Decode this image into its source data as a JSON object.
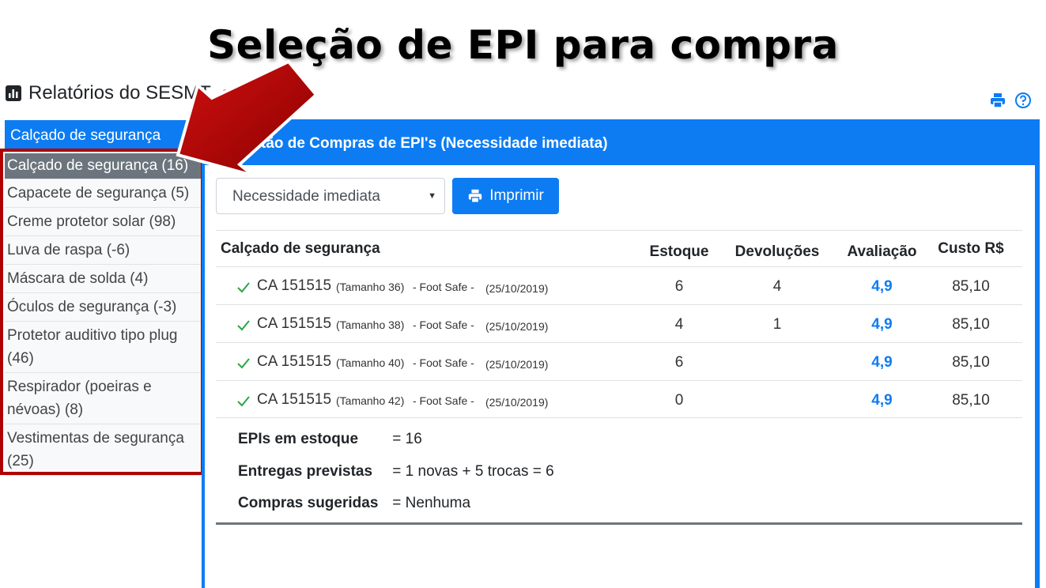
{
  "slide": {
    "title": "Seleção de EPI para compra"
  },
  "app": {
    "title": "Relatórios do SESMT"
  },
  "sidebar": {
    "selected_label": "Calçado de segurança",
    "items": [
      {
        "label": "Calçado de segurança (16)"
      },
      {
        "label": "Capacete de segurança (5)"
      },
      {
        "label": "Creme protetor solar (98)"
      },
      {
        "label": "Luva de raspa (-6)"
      },
      {
        "label": "Máscara de solda (4)"
      },
      {
        "label": "Óculos de segurança (-3)"
      },
      {
        "label": "Protetor auditivo tipo plug (46)"
      },
      {
        "label": "Respirador (poeiras e névoas) (8)"
      },
      {
        "label": "Vestimentas de segurança (25)"
      }
    ]
  },
  "panel": {
    "title": "Sugestão de Compras de EPI's (Necessidade imediata)",
    "filter_value": "Necessidade imediata",
    "print_label": "Imprimir"
  },
  "table": {
    "headers": {
      "item": "Calçado de segurança",
      "estoque": "Estoque",
      "devolucoes": "Devoluções",
      "avaliacao": "Avaliação",
      "custo": "Custo R$"
    },
    "rows": [
      {
        "ca": "CA 151515",
        "tamanho": "(Tamanho 36)",
        "fabricante": "- Foot Safe -",
        "data": "(25/10/2019)",
        "estoque": "6",
        "devolucoes": "4",
        "avaliacao": "4,9",
        "custo": "85,10"
      },
      {
        "ca": "CA 151515",
        "tamanho": "(Tamanho 38)",
        "fabricante": "- Foot Safe -",
        "data": "(25/10/2019)",
        "estoque": "4",
        "devolucoes": "1",
        "avaliacao": "4,9",
        "custo": "85,10"
      },
      {
        "ca": "CA 151515",
        "tamanho": "(Tamanho 40)",
        "fabricante": "- Foot Safe -",
        "data": "(25/10/2019)",
        "estoque": "6",
        "devolucoes": "",
        "avaliacao": "4,9",
        "custo": "85,10"
      },
      {
        "ca": "CA 151515",
        "tamanho": "(Tamanho 42)",
        "fabricante": "- Foot Safe -",
        "data": "(25/10/2019)",
        "estoque": "0",
        "devolucoes": "",
        "avaliacao": "4,9",
        "custo": "85,10"
      }
    ]
  },
  "summary": {
    "estoque_label": "EPIs em estoque",
    "estoque_value": "=  16",
    "entregas_label": "Entregas previstas",
    "entregas_value": "=  1 novas + 5 trocas = 6",
    "compras_label": "Compras sugeridas",
    "compras_value": "=  Nenhuma"
  },
  "colors": {
    "primary": "#0d7cf2",
    "highlight": "#b00000",
    "active_item": "#6c757d",
    "check": "#28a745"
  },
  "icons": {
    "header": "bar-chart-icon",
    "undo": "undo-icon",
    "print": "printer-icon",
    "help": "help-circle-icon",
    "check": "check-icon"
  }
}
